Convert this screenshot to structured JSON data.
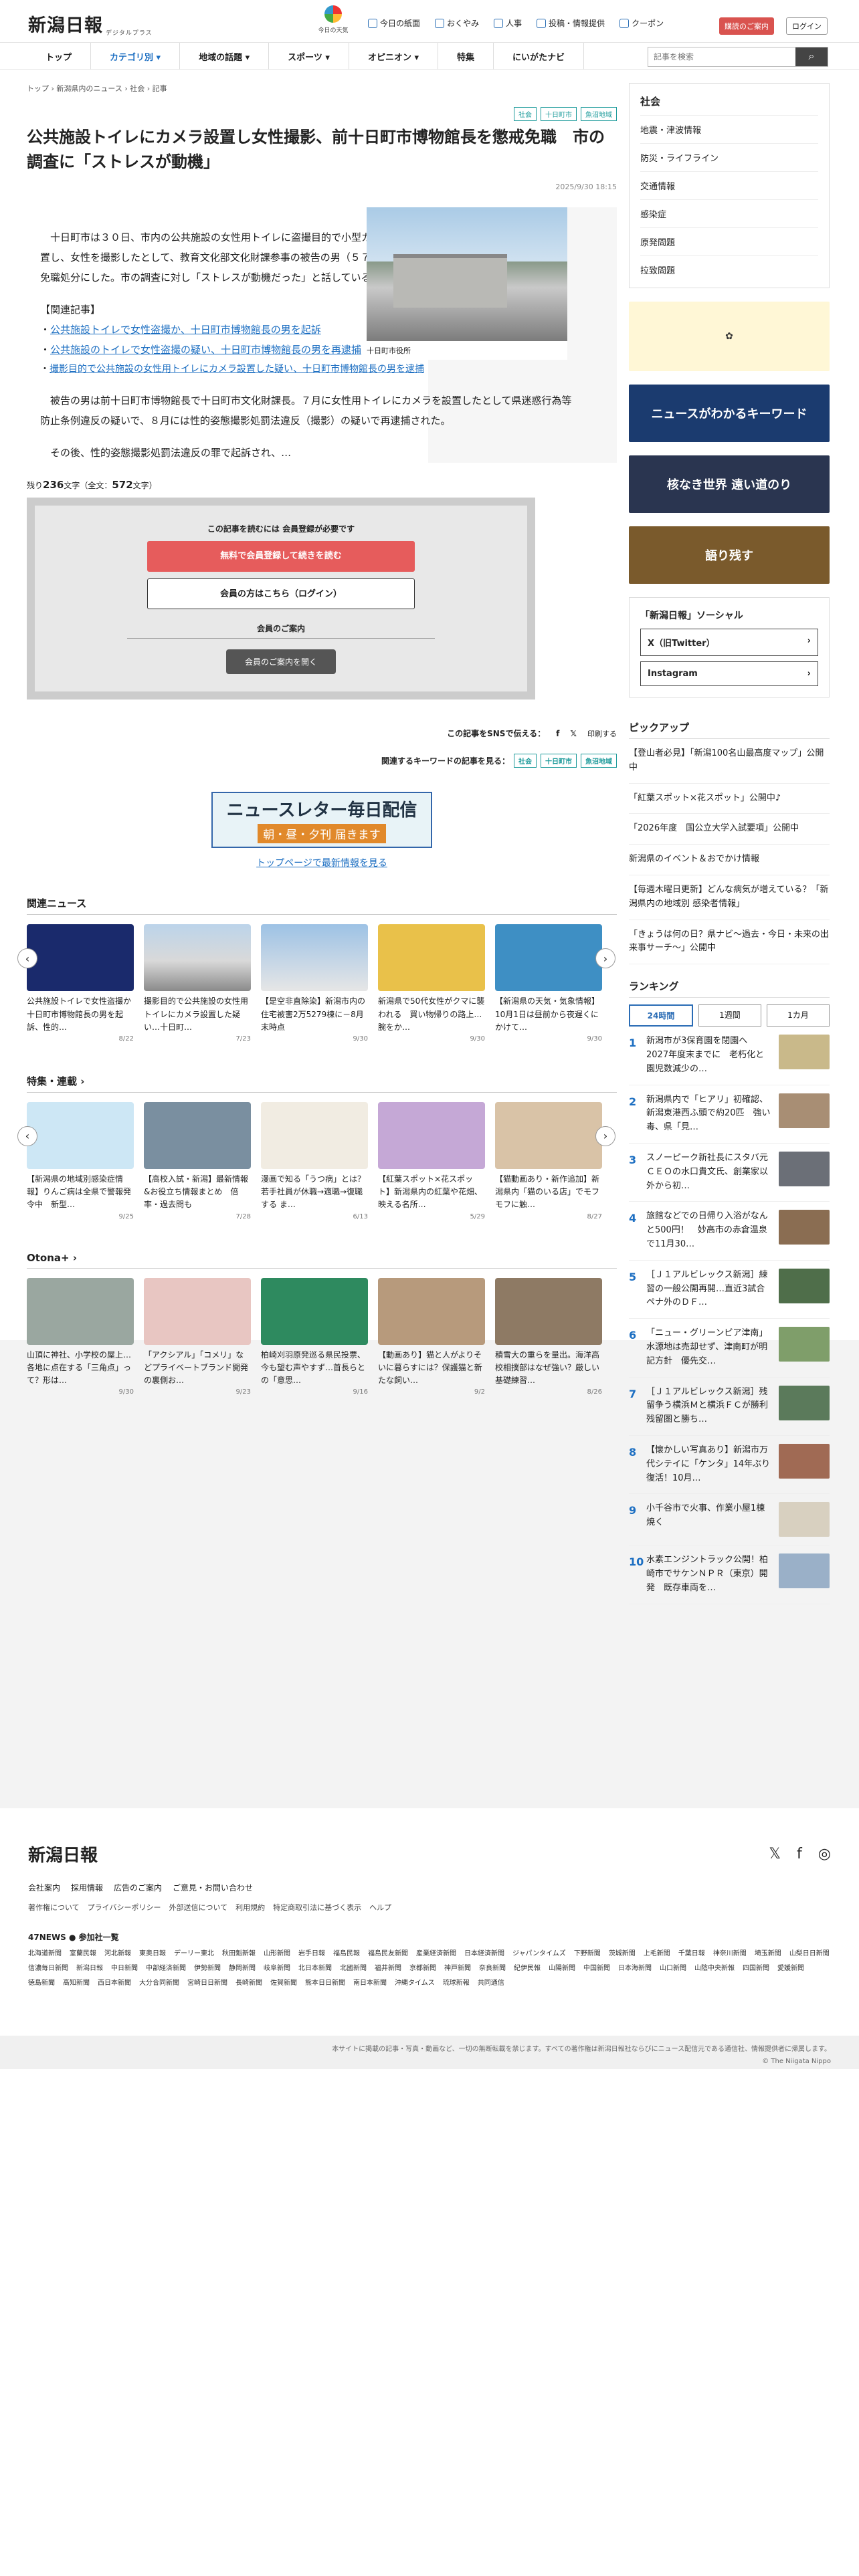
{
  "header": {
    "logo": "新潟日報",
    "logo_sub": "デジタルプラス",
    "today": "今日の天気",
    "links": [
      "今日の紙面",
      "おくやみ",
      "人事",
      "投稿・情報提供",
      "クーポン"
    ],
    "shop": "購読のご案内",
    "login": "ログイン"
  },
  "nav": {
    "items": [
      "トップ",
      "カテゴリ別 ▾",
      "地域の話題 ▾",
      "スポーツ ▾",
      "オピニオン ▾",
      "特集",
      "にいがたナビ"
    ],
    "search_placeholder": "記事を検索"
  },
  "crumb": "トップ › 新潟県内のニュース › 社会 › 記事",
  "tags": [
    "社会",
    "十日町市",
    "魚沼地域"
  ],
  "title": "公共施設トイレにカメラ設置し女性撮影、前十日町市博物館長を懲戒免職　市の調査に「ストレスが動機」",
  "date": "2025/9/30 18:15",
  "photo_caption": "十日町市役所",
  "body": {
    "p1": "　十日町市は３０日、市内の公共施設の女性用トイレに盗撮目的で小型カメラを設置し、女性を撮影したとして、教育文化部文化財課参事の被告の男（５７）を懲戒免職処分にした。市の調査に対し「ストレスが動機だった」と話しているという。",
    "rel_head": "【関連記事】",
    "rel": [
      "公共施設トイレで女性盗撮か、十日町市博物館長の男を起訴",
      "公共施設のトイレで女性盗撮の疑い、十日町市博物館長の男を再逮捕",
      "撮影目的で公共施設の女性用トイレにカメラ設置した疑い、十日町市博物館長の男を逮捕"
    ],
    "p2": "　被告の男は前十日町市博物館長で十日町市文化財課長。７月に女性用トイレにカメラを設置したとして県迷惑行為等防止条例違反の疑いで、８月には性的姿態撮影処罰法違反（撮影）の疑いで再逮捕された。",
    "p3": "　その後、性的姿態撮影処罰法違反の罪で起訴され、…"
  },
  "remain": {
    "prefix": "残り",
    "num": "236",
    "suffix": "文字（全文：",
    "total": "572",
    "end": "文字）"
  },
  "paywall": {
    "title": "この記事を読むには 会員登録が必要です",
    "signup": "無料で会員登録して続きを読む",
    "login": "会員の方はこちら（ログイン）",
    "guide": "会員のご案内",
    "guide_btn": "会員のご案内を開く"
  },
  "share": {
    "label": "この記事をSNSで伝える：",
    "print": "印刷する"
  },
  "kw": {
    "label": "関連するキーワードの記事を見る："
  },
  "newsletter": {
    "a": "ニュースレター毎日配信",
    "b": "朝・昼・夕刊 届きます"
  },
  "toplink": "トップページで最新情報を見る",
  "related": {
    "title": "関連ニュース",
    "items": [
      {
        "t": "公共施設トイレで女性盗撮か　十日町市博物館長の男を起訴、性的…",
        "d": "8/22"
      },
      {
        "t": "撮影目的で公共施設の女性用トイレにカメラ設置した疑い…十日町…",
        "d": "7/23"
      },
      {
        "t": "【是空非直除染】新潟市内の住宅被害2万5279棟に－8月末時点",
        "d": "9/30"
      },
      {
        "t": "新潟県で50代女性がクマに襲われる　買い物帰りの路上…腕をか…",
        "d": "9/30"
      },
      {
        "t": "【新潟県の天気・気象情報】10月1日は昼前から夜遅くにかけて…",
        "d": "9/30"
      }
    ]
  },
  "features": {
    "title": "特集・連載 ›",
    "items": [
      {
        "t": "【新潟県の地域別感染症情報】りんご病は全県で警報発令中　新型…",
        "d": "9/25"
      },
      {
        "t": "【高校入試・新潟】最新情報&お役立ち情報まとめ　倍率・過去問も",
        "d": "7/28"
      },
      {
        "t": "漫画で知る「うつ病」とは？ 若手社員が休職→適職→復職する ま…",
        "d": "6/13"
      },
      {
        "t": "【紅葉スポット×花スポット】新潟県内の紅葉や花畑、映える名所…",
        "d": "5/29"
      },
      {
        "t": "【猫動画あり・新作追加】新潟県内「猫のいる店」でモフモフに触…",
        "d": "8/27"
      }
    ]
  },
  "otona": {
    "title": "Otona+ ›",
    "items": [
      {
        "t": "山頂に神社、小学校の屋上…各地に点在する「三角点」って？形は…",
        "d": "9/30"
      },
      {
        "t": "「アクシアル」「コメリ」などプライベートブランド開発の裏側お…",
        "d": "9/23"
      },
      {
        "t": "柏崎刈羽原発巡る県民投票、今も望む声やすず…首長らとの「意思…",
        "d": "9/16"
      },
      {
        "t": "【動画あり】猫と人がよりそいに暮らすには？保護猫と新たな飼い…",
        "d": "9/2"
      },
      {
        "t": "積雪大の重らを量出。海洋高校相撲部はなぜ強い？厳しい基礎練習…",
        "d": "8/26"
      }
    ]
  },
  "sidebar": {
    "cat_title": "社会",
    "cats": [
      "地震・津波情報",
      "防災・ライフライン",
      "交通情報",
      "感染症",
      "原発問題",
      "拉致問題"
    ],
    "banners": [
      "ニュースがわかるキーワード",
      "核なき世界 遠い道のり",
      "語り残す"
    ],
    "social_title": "「新潟日報」ソーシャル",
    "x": "X（旧Twitter）",
    "ig": "Instagram"
  },
  "pickup": {
    "title": "ピックアップ",
    "items": [
      "【登山者必見】「新潟100名山最高度マップ」公開中",
      "「紅葉スポット×花スポット」公開中♪",
      "「2026年度　国公立大学入試要項」公開中",
      "新潟県のイベント＆おでかけ情報",
      "【毎週木曜日更新】どんな病気が増えている？「新潟県内の地域別 感染者情報」",
      "「きょうは何の日？県ナビ～過去・今日・未来の出来事サーチ～」公開中"
    ]
  },
  "ranking": {
    "title": "ランキング",
    "tabs": [
      "24時間",
      "1週間",
      "1カ月"
    ],
    "items": [
      "新潟市が3保育園を閉園へ　2027年度末までに　老朽化と園児数減少の…",
      "新潟県内で「ヒアリ」初確認、新潟東港西ふ頭で約20匹　強い毒、県「見…",
      "スノーピーク新社長にスタバ元ＣＥＯの水口貴文氏、創業家以外から初…",
      "旅館などでの日帰り入浴がなんと500円！　妙高市の赤倉温泉で11月30…",
      "［Ｊ１アルビレックス新潟］練習の一般公開再開…直近3試合ペナ外のＤＦ…",
      "「ニュー・グリーンピア津南」水源地は売却せず、津南町が明記方針　優先交…",
      "［Ｊ１アルビレックス新潟］残留争う横浜Ｍと横浜ＦＣが勝利　残留圏と勝ち…",
      "【懐かしい写真あり】新潟市万代シテイに「ケンタ」14年ぶり復活！10月…",
      "小千谷市で火事、作業小屋1棟焼く",
      "水素エンジントラック公開！柏崎市でサケンＮＰＲ（東京）開発　既存車両を…"
    ]
  },
  "footer": {
    "logo": "新潟日報",
    "l1": [
      "会社案内",
      "採用情報",
      "広告のご案内",
      "ご意見・お問い合わせ"
    ],
    "l2": [
      "著作権について",
      "プライバシーポリシー",
      "外部送信について",
      "利用規約",
      "特定商取引法に基づく表示",
      "ヘルプ"
    ],
    "n47": "47NEWS ● 参加社一覧",
    "papers": [
      "北海道新聞",
      "室蘭民報",
      "河北新報",
      "東奥日報",
      "デーリー東北",
      "秋田魁新報",
      "山形新聞",
      "岩手日報",
      "福島民報",
      "福島民友新聞",
      "産業経済新聞",
      "日本経済新聞",
      "ジャパンタイムズ",
      "下野新聞",
      "茨城新聞",
      "上毛新聞",
      "千葉日報",
      "神奈川新聞",
      "埼玉新聞",
      "山梨日日新聞",
      "信濃毎日新聞",
      "新潟日報",
      "中日新聞",
      "中部経済新聞",
      "伊勢新聞",
      "静岡新聞",
      "岐阜新聞",
      "北日本新聞",
      "北國新聞",
      "福井新聞",
      "京都新聞",
      "神戸新聞",
      "奈良新聞",
      "紀伊民報",
      "山陽新聞",
      "中国新聞",
      "日本海新聞",
      "山口新聞",
      "山陰中央新報",
      "四国新聞",
      "愛媛新聞",
      "徳島新聞",
      "高知新聞",
      "西日本新聞",
      "大分合同新聞",
      "宮崎日日新聞",
      "長崎新聞",
      "佐賀新聞",
      "熊本日日新聞",
      "南日本新聞",
      "沖縄タイムス",
      "琉球新報",
      "共同通信"
    ],
    "copy1": "本サイトに掲載の記事・写真・動画など、一切の無断転載を禁じます。すべての著作権は新潟日報社ならびにニュース配信元である通信社、情報提供者に帰属します。",
    "copy2": "© The Niigata Nippo"
  }
}
